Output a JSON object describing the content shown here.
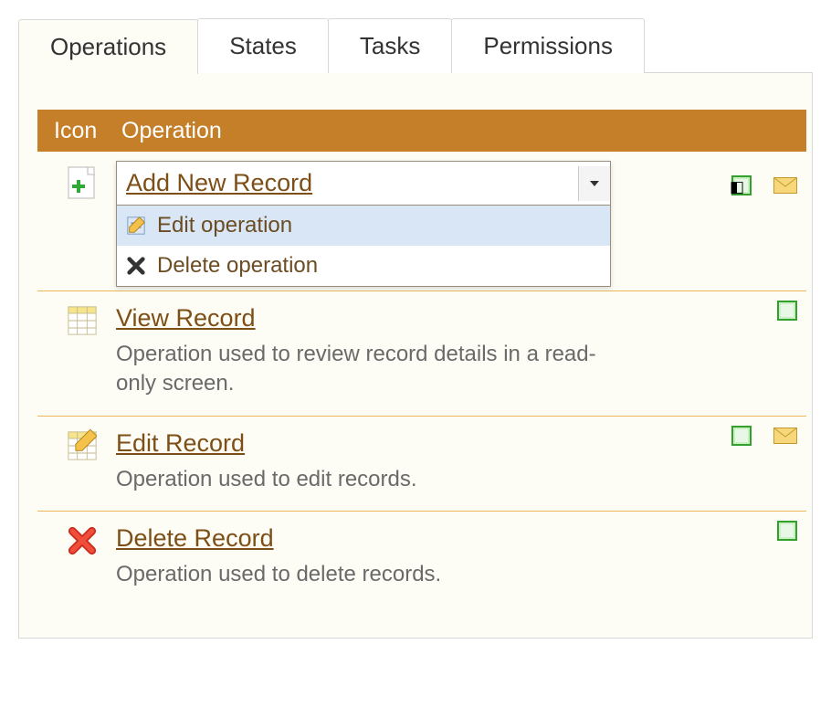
{
  "tabs": [
    {
      "label": "Operations",
      "active": true
    },
    {
      "label": "States",
      "active": false
    },
    {
      "label": "Tasks",
      "active": false
    },
    {
      "label": "Permissions",
      "active": false
    }
  ],
  "table": {
    "headers": {
      "icon": "Icon",
      "operation": "Operation"
    },
    "rows": [
      {
        "name": "Add New Record",
        "description": "",
        "icon": "add",
        "actions": {
          "green": true,
          "green_dark": true,
          "mail": true
        },
        "dropdown": {
          "open": true,
          "items": [
            {
              "label": "Edit operation",
              "icon": "edit",
              "active": true
            },
            {
              "label": "Delete operation",
              "icon": "delete",
              "active": false
            }
          ]
        }
      },
      {
        "name": "View Record",
        "description": "Operation used to review record details in a read-only screen.",
        "icon": "grid",
        "actions": {
          "green": true,
          "green_dark": false,
          "mail": false
        }
      },
      {
        "name": "Edit Record",
        "description": "Operation used to edit records.",
        "icon": "grid-edit",
        "actions": {
          "green": true,
          "green_dark": false,
          "mail": true
        }
      },
      {
        "name": "Delete Record",
        "description": "Operation used to delete records.",
        "icon": "delete-x",
        "actions": {
          "green": true,
          "green_dark": false,
          "mail": false
        }
      }
    ]
  }
}
